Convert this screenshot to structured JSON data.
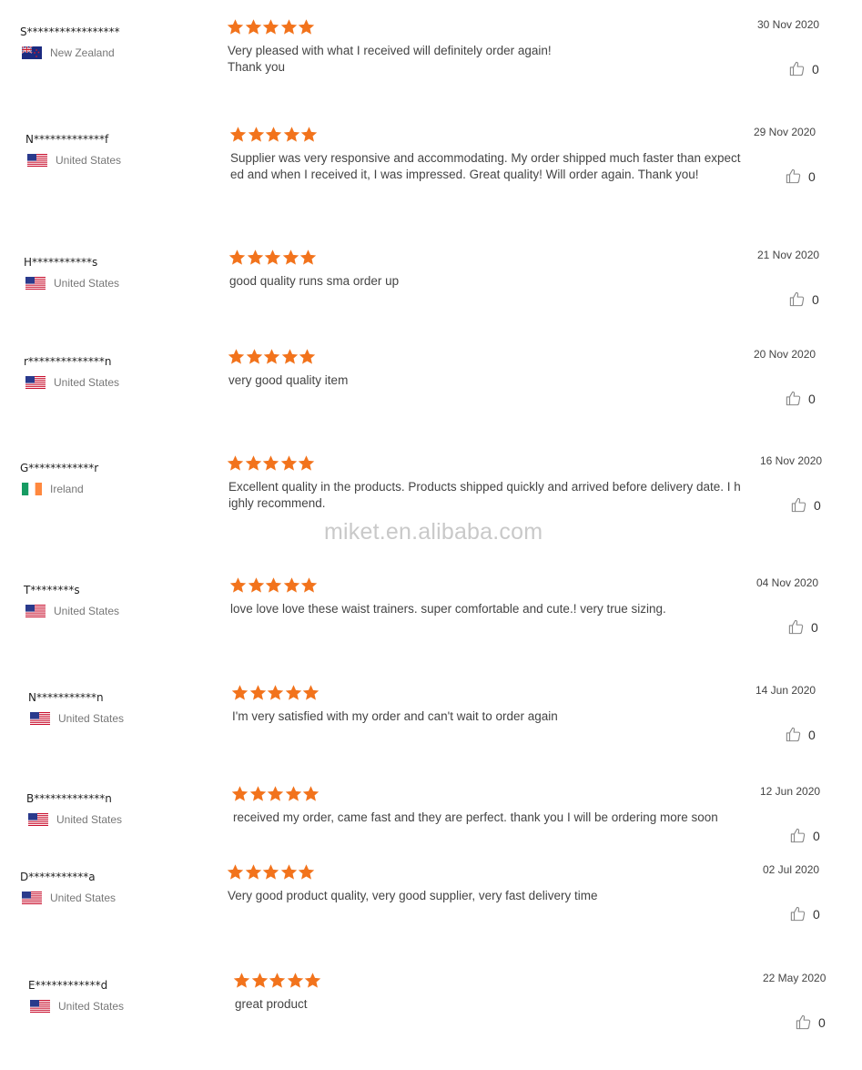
{
  "accent_color": "#f2731c",
  "watermark": "miket.en.alibaba.com",
  "reviews": [
    {
      "name": "S*****************",
      "country": "New Zealand",
      "flag": "nz",
      "rating": 5,
      "text": "Very pleased with what I received will definitely order again!\nThank you",
      "date": "30 Nov 2020",
      "likes": "0"
    },
    {
      "name": "N*************f",
      "country": "United States",
      "flag": "us",
      "rating": 5,
      "text": "Supplier was very responsive and accommodating. My order shipped much faster than expected and when I received it, I was impressed. Great quality! Will order again. Thank you!",
      "date": "29 Nov 2020",
      "likes": "0"
    },
    {
      "name": "H***********s",
      "country": "United States",
      "flag": "us",
      "rating": 5,
      "text": "good quality runs sma order up",
      "date": "21 Nov 2020",
      "likes": "0"
    },
    {
      "name": "r**************n",
      "country": "United States",
      "flag": "us",
      "rating": 5,
      "text": "very good quality item",
      "date": "20 Nov 2020",
      "likes": "0"
    },
    {
      "name": "G************r",
      "country": "Ireland",
      "flag": "ie",
      "rating": 5,
      "text": "Excellent quality in the products. Products shipped quickly and arrived before delivery date. I highly recommend.",
      "date": "16 Nov 2020",
      "likes": "0"
    },
    {
      "name": "T********s",
      "country": "United States",
      "flag": "us",
      "rating": 5,
      "text": "love love love these waist trainers. super comfortable and cute.! very true sizing.",
      "date": "04 Nov 2020",
      "likes": "0"
    },
    {
      "name": "N***********n",
      "country": "United States",
      "flag": "us",
      "rating": 5,
      "text": "I'm very satisfied with my order and can't wait to order again",
      "date": "14 Jun 2020",
      "likes": "0"
    },
    {
      "name": "B*************n",
      "country": "United States",
      "flag": "us",
      "rating": 5,
      "text": "received my order, came fast and they are perfect. thank you I will be ordering more soon",
      "date": "12 Jun 2020",
      "likes": "0"
    },
    {
      "name": "D***********a",
      "country": "United States",
      "flag": "us",
      "rating": 5,
      "text": "Very good product quality, very good supplier, very fast delivery time",
      "date": "02 Jul 2020",
      "likes": "0"
    },
    {
      "name": "E************d",
      "country": "United States",
      "flag": "us",
      "rating": 5,
      "text": "great product",
      "date": "22 May 2020",
      "likes": "0"
    }
  ]
}
